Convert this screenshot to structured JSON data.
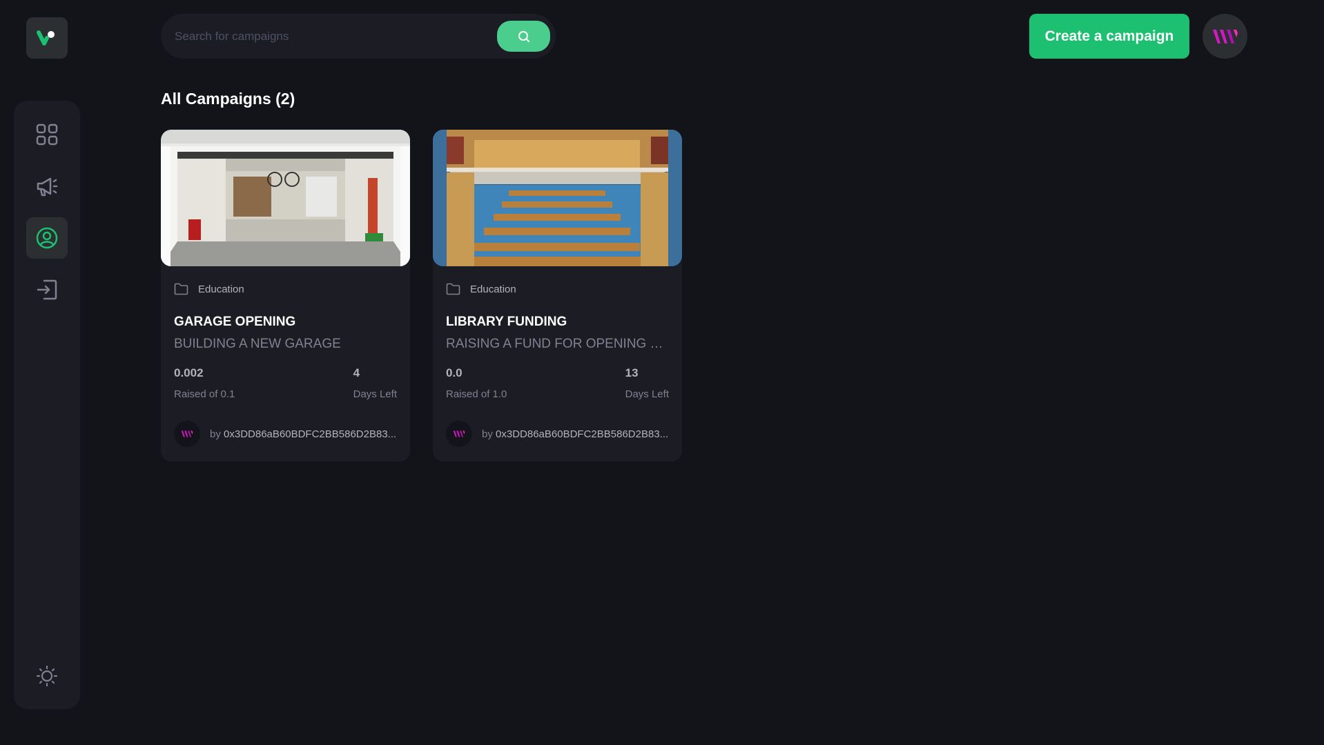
{
  "header": {
    "search": {
      "placeholder": "Search for campaigns"
    },
    "create_button_label": "Create a campaign"
  },
  "colors": {
    "background": "#13131a",
    "surface": "#1c1c24",
    "accent": "#1dc071",
    "search_accent": "#4acd8d",
    "active_icon": "#1dc071",
    "avatar_magenta": "#d219c4"
  },
  "sidebar": {
    "logo_icon": "logo-icon",
    "items": [
      {
        "name": "dashboard",
        "icon": "grid-icon",
        "active": false
      },
      {
        "name": "campaign",
        "icon": "megaphone-icon",
        "active": false
      },
      {
        "name": "profile",
        "icon": "user-circle-icon",
        "active": true
      },
      {
        "name": "logout",
        "icon": "logout-icon",
        "active": false
      }
    ],
    "theme_toggle_icon": "sun-icon"
  },
  "main": {
    "section_title": "All Campaigns (2)",
    "campaigns": [
      {
        "image": "garage-photo",
        "category": "Education",
        "title": "GARAGE OPENING",
        "description": "BUILDING A NEW GARAGE",
        "raised": "0.002",
        "raised_label": "Raised of 0.1",
        "days_left": "4",
        "days_left_label": "Days Left",
        "by": "by",
        "owner": "0x3DD86aB60BDFC2BB586D2B83..."
      },
      {
        "image": "library-photo",
        "category": "Education",
        "title": "LIBRARY FUNDING",
        "description": "RAISING A FUND FOR OPENING LIB...",
        "raised": "0.0",
        "raised_label": "Raised of 1.0",
        "days_left": "13",
        "days_left_label": "Days Left",
        "by": "by",
        "owner": "0x3DD86aB60BDFC2BB586D2B83..."
      }
    ]
  }
}
